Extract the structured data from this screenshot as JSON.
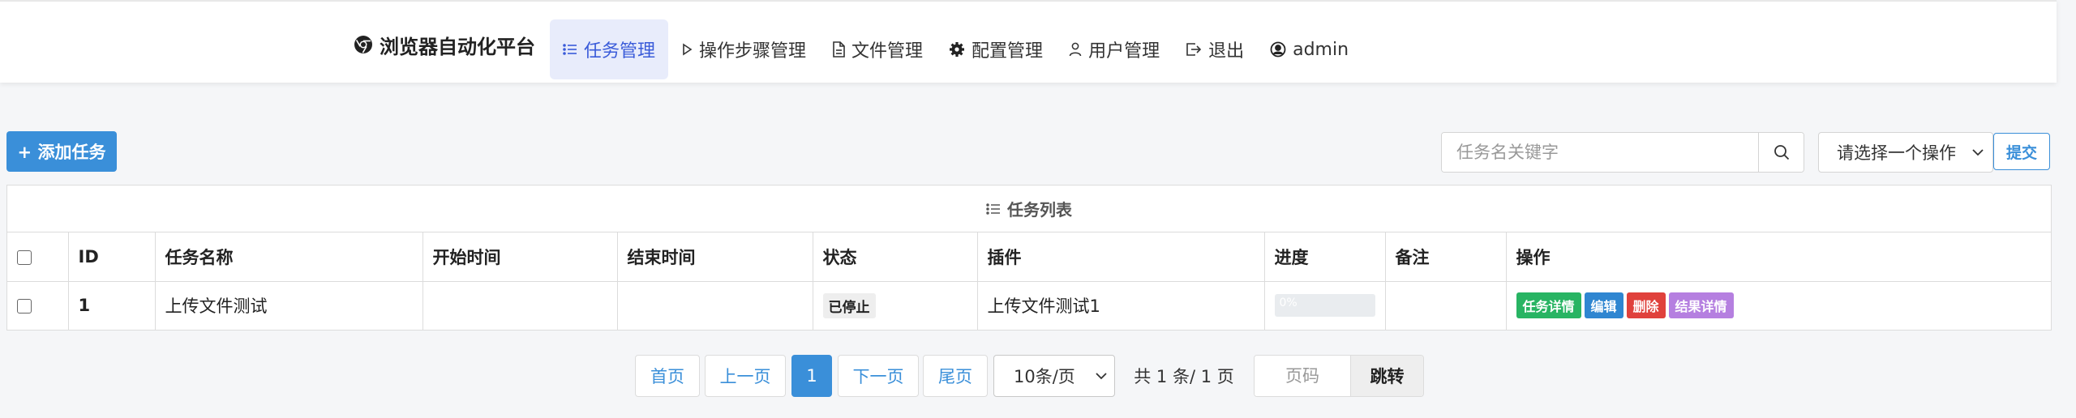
{
  "brand": {
    "title": "浏览器自动化平台",
    "icon": "chrome-icon"
  },
  "nav": {
    "items": [
      {
        "label": "任务管理",
        "icon": "list-icon",
        "active": true
      },
      {
        "label": "操作步骤管理",
        "icon": "play-icon"
      },
      {
        "label": "文件管理",
        "icon": "file-icon"
      },
      {
        "label": "配置管理",
        "icon": "gear-icon"
      },
      {
        "label": "用户管理",
        "icon": "user-icon"
      },
      {
        "label": "退出",
        "icon": "logout-icon"
      },
      {
        "label": "admin",
        "icon": "user-circle-icon"
      }
    ]
  },
  "toolbar": {
    "add_label": "+ 添加任务",
    "search_placeholder": "任务名关键字",
    "operation_selected": "请选择一个操作",
    "submit_label": "提交"
  },
  "table": {
    "title": "任务列表",
    "columns": [
      "ID",
      "任务名称",
      "开始时间",
      "结束时间",
      "状态",
      "插件",
      "进度",
      "备注",
      "操作"
    ],
    "rows": [
      {
        "id": "1",
        "name": "上传文件测试",
        "start_time": "",
        "end_time": "",
        "status": "已停止",
        "plugin": "上传文件测试1",
        "progress_label": "0%",
        "progress_value": 0,
        "note": "",
        "actions": [
          "任务详情",
          "编辑",
          "删除",
          "结果详情"
        ]
      }
    ]
  },
  "pagination": {
    "first": "首页",
    "prev": "上一页",
    "current": "1",
    "next": "下一页",
    "last": "尾页",
    "page_size": "10条/页",
    "total_text": "共 1 条/ 1 页",
    "page_input_placeholder": "页码",
    "jump_label": "跳转"
  },
  "colors": {
    "primary": "#3a8fd9",
    "nav_active_bg": "#e8ecfb",
    "nav_active_text": "#3a5bd9",
    "success": "#28b463",
    "danger": "#e0413c",
    "purple": "#b57fe0"
  }
}
